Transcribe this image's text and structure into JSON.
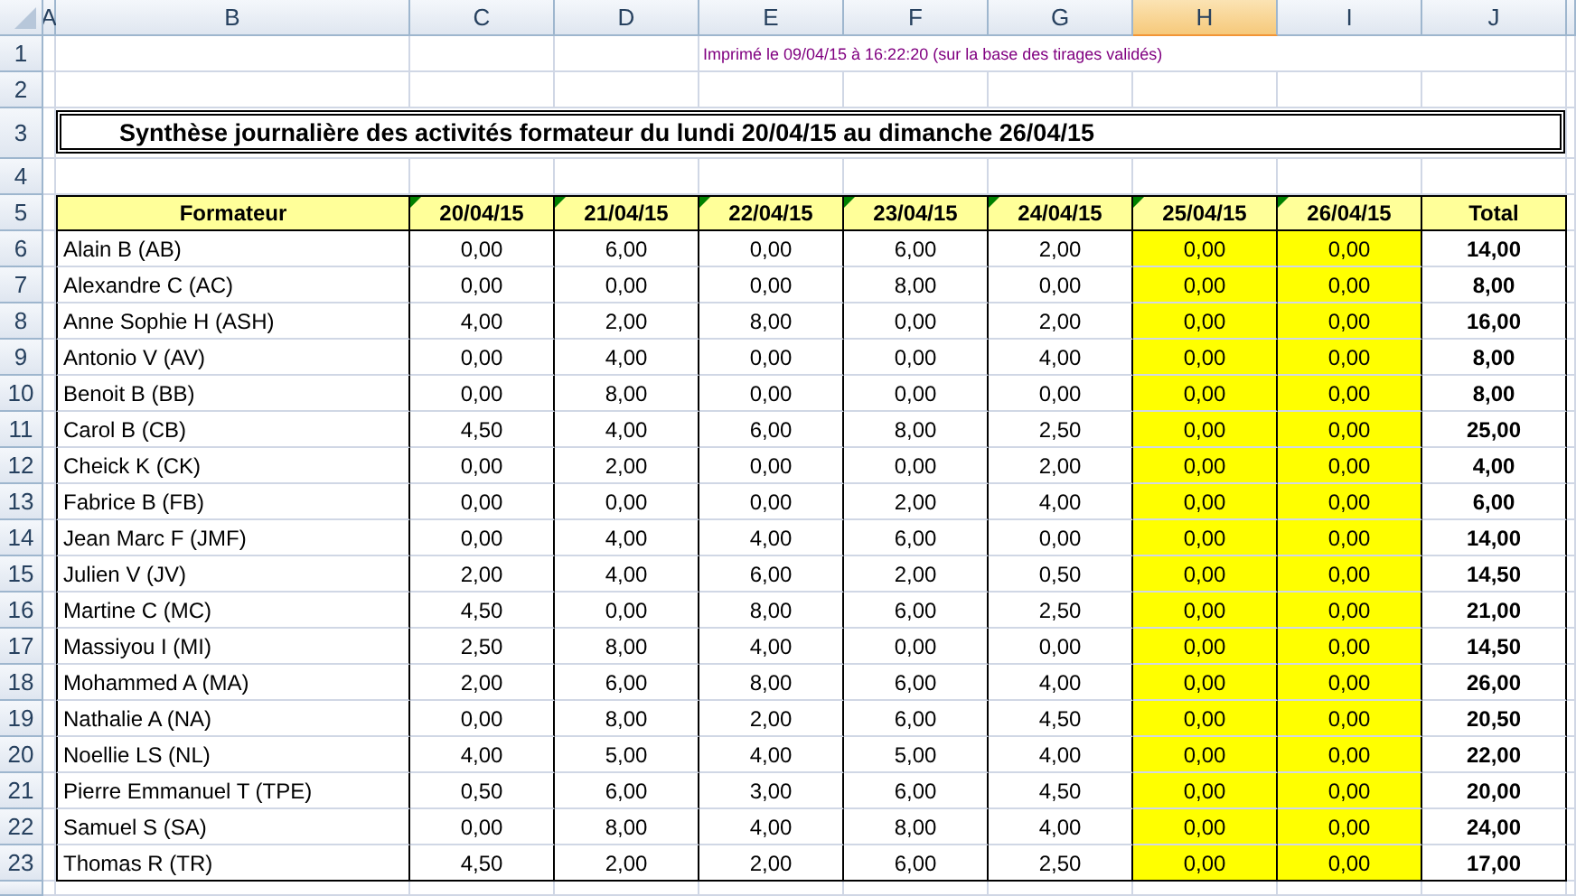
{
  "column_letters": [
    {
      "label": "A",
      "selected": false
    },
    {
      "label": "B",
      "selected": false
    },
    {
      "label": "C",
      "selected": false
    },
    {
      "label": "D",
      "selected": false
    },
    {
      "label": "E",
      "selected": false
    },
    {
      "label": "F",
      "selected": false
    },
    {
      "label": "G",
      "selected": false
    },
    {
      "label": "H",
      "selected": true
    },
    {
      "label": "I",
      "selected": false
    },
    {
      "label": "J",
      "selected": false
    }
  ],
  "row_numbers": [
    "1",
    "2",
    "3",
    "4",
    "5",
    "6",
    "7",
    "8",
    "9",
    "10",
    "11",
    "12",
    "13",
    "14",
    "15",
    "16",
    "17",
    "18",
    "19",
    "20",
    "21",
    "22",
    "23"
  ],
  "print_note": "Imprimé le 09/04/15 à 16:22:20 (sur la base des tirages validés)",
  "title": "Synthèse journalière des activités formateur du lundi 20/04/15 au dimanche 26/04/15",
  "table": {
    "columns": [
      {
        "label": "Formateur",
        "kind": "name",
        "highlighted": false,
        "flagged": false
      },
      {
        "label": "20/04/15",
        "kind": "number",
        "highlighted": false,
        "flagged": true
      },
      {
        "label": "21/04/15",
        "kind": "number",
        "highlighted": false,
        "flagged": true
      },
      {
        "label": "22/04/15",
        "kind": "number",
        "highlighted": false,
        "flagged": true
      },
      {
        "label": "23/04/15",
        "kind": "number",
        "highlighted": false,
        "flagged": true
      },
      {
        "label": "24/04/15",
        "kind": "number",
        "highlighted": false,
        "flagged": true
      },
      {
        "label": "25/04/15",
        "kind": "number",
        "highlighted": true,
        "flagged": true
      },
      {
        "label": "26/04/15",
        "kind": "number",
        "highlighted": true,
        "flagged": true
      },
      {
        "label": "Total",
        "kind": "total",
        "highlighted": false,
        "flagged": false
      }
    ],
    "rows": [
      [
        "Alain B (AB)",
        "0,00",
        "6,00",
        "0,00",
        "6,00",
        "2,00",
        "0,00",
        "0,00",
        "14,00"
      ],
      [
        "Alexandre C (AC)",
        "0,00",
        "0,00",
        "0,00",
        "8,00",
        "0,00",
        "0,00",
        "0,00",
        "8,00"
      ],
      [
        "Anne Sophie H (ASH)",
        "4,00",
        "2,00",
        "8,00",
        "0,00",
        "2,00",
        "0,00",
        "0,00",
        "16,00"
      ],
      [
        "Antonio V (AV)",
        "0,00",
        "4,00",
        "0,00",
        "0,00",
        "4,00",
        "0,00",
        "0,00",
        "8,00"
      ],
      [
        "Benoit B (BB)",
        "0,00",
        "8,00",
        "0,00",
        "0,00",
        "0,00",
        "0,00",
        "0,00",
        "8,00"
      ],
      [
        "Carol B (CB)",
        "4,50",
        "4,00",
        "6,00",
        "8,00",
        "2,50",
        "0,00",
        "0,00",
        "25,00"
      ],
      [
        "Cheick K (CK)",
        "0,00",
        "2,00",
        "0,00",
        "0,00",
        "2,00",
        "0,00",
        "0,00",
        "4,00"
      ],
      [
        "Fabrice B (FB)",
        "0,00",
        "0,00",
        "0,00",
        "2,00",
        "4,00",
        "0,00",
        "0,00",
        "6,00"
      ],
      [
        "Jean Marc F (JMF)",
        "0,00",
        "4,00",
        "4,00",
        "6,00",
        "0,00",
        "0,00",
        "0,00",
        "14,00"
      ],
      [
        "Julien V (JV)",
        "2,00",
        "4,00",
        "6,00",
        "2,00",
        "0,50",
        "0,00",
        "0,00",
        "14,50"
      ],
      [
        "Martine C (MC)",
        "4,50",
        "0,00",
        "8,00",
        "6,00",
        "2,50",
        "0,00",
        "0,00",
        "21,00"
      ],
      [
        "Massiyou I (MI)",
        "2,50",
        "8,00",
        "4,00",
        "0,00",
        "0,00",
        "0,00",
        "0,00",
        "14,50"
      ],
      [
        "Mohammed A (MA)",
        "2,00",
        "6,00",
        "8,00",
        "6,00",
        "4,00",
        "0,00",
        "0,00",
        "26,00"
      ],
      [
        "Nathalie A (NA)",
        "0,00",
        "8,00",
        "2,00",
        "6,00",
        "4,50",
        "0,00",
        "0,00",
        "20,50"
      ],
      [
        "Noellie LS (NL)",
        "4,00",
        "5,00",
        "4,00",
        "5,00",
        "4,00",
        "0,00",
        "0,00",
        "22,00"
      ],
      [
        "Pierre Emmanuel T (TPE)",
        "0,50",
        "6,00",
        "3,00",
        "6,00",
        "4,50",
        "0,00",
        "0,00",
        "20,00"
      ],
      [
        "Samuel S (SA)",
        "0,00",
        "8,00",
        "4,00",
        "8,00",
        "4,00",
        "0,00",
        "0,00",
        "24,00"
      ],
      [
        "Thomas R (TR)",
        "4,50",
        "2,00",
        "2,00",
        "6,00",
        "2,50",
        "0,00",
        "0,00",
        "17,00"
      ]
    ]
  }
}
